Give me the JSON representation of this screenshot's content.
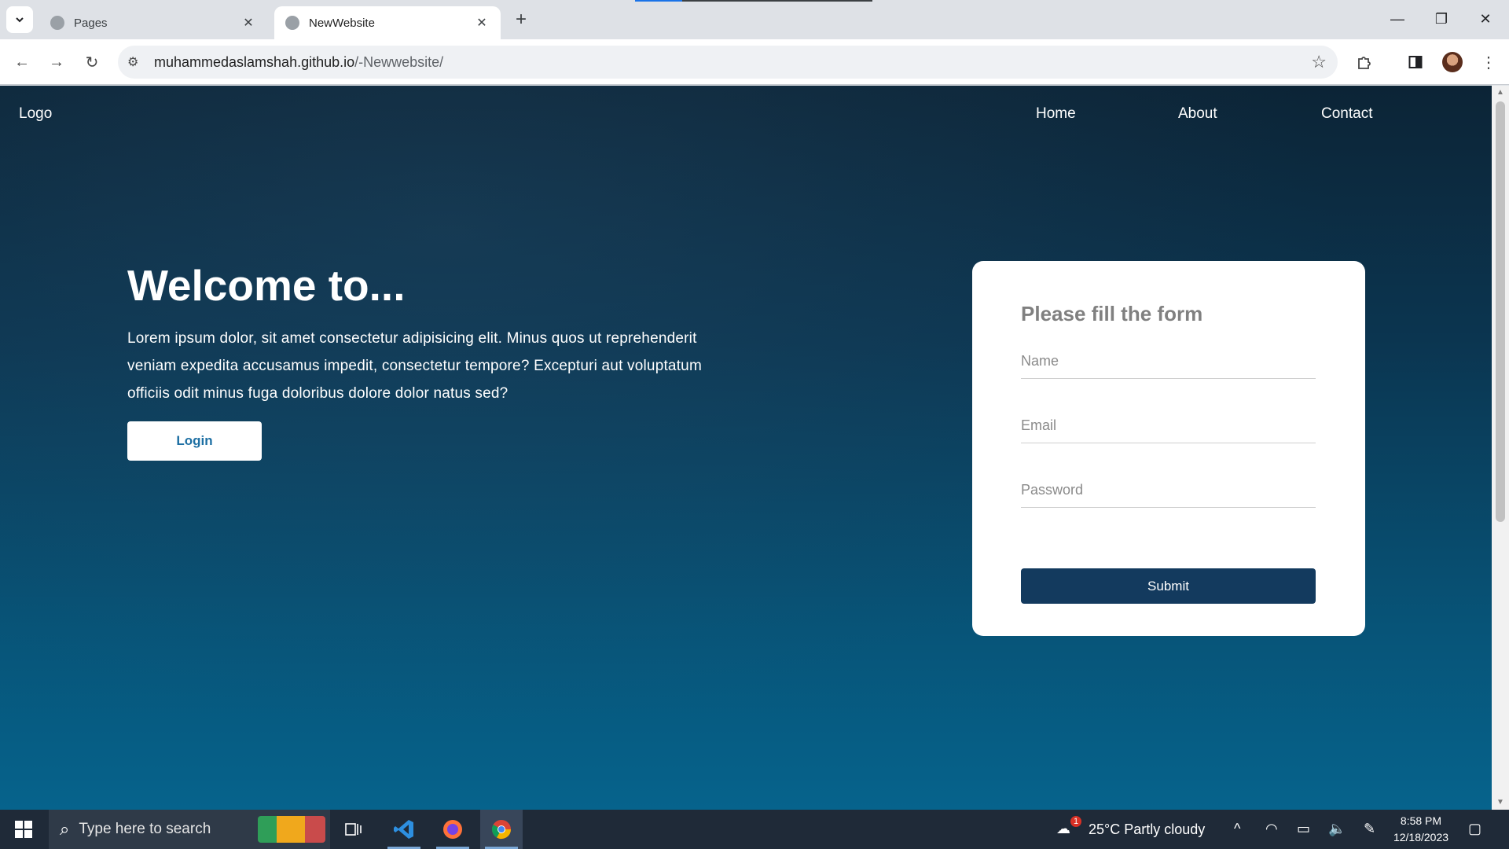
{
  "browser": {
    "tabs": [
      {
        "title": "Pages",
        "active": false
      },
      {
        "title": "NewWebsite",
        "active": true
      }
    ],
    "url_host": "muhammedaslamshah.github.io",
    "url_path": "/-Newwebsite/",
    "icons": {
      "tab_list": "chevron-down-icon",
      "close": "close-icon",
      "new_tab": "plus-icon",
      "back": "back-arrow-icon",
      "forward": "forward-arrow-icon",
      "reload": "reload-icon",
      "site_settings": "tune-icon",
      "bookmark": "star-icon",
      "extensions": "puzzle-icon",
      "side_panel": "side-panel-icon",
      "menu": "kebab-menu-icon"
    }
  },
  "page": {
    "nav": {
      "logo": "Logo",
      "links": [
        "Home",
        "About",
        "Contact"
      ]
    },
    "hero": {
      "title": "Welcome to...",
      "text": "Lorem ipsum dolor, sit amet consectetur adipisicing elit. Minus quos ut reprehenderit veniam expedita accusamus impedit, consectetur tempore? Excepturi aut voluptatum officiis odit minus fuga doloribus dolore dolor natus sed?",
      "login_label": "Login"
    },
    "form": {
      "title": "Please fill the form",
      "name_placeholder": "Name",
      "email_placeholder": "Email",
      "password_placeholder": "Password",
      "submit_label": "Submit"
    },
    "colors": {
      "submit_bg": "#133a5e",
      "login_text": "#1d6fa3"
    }
  },
  "taskbar": {
    "search_placeholder": "Type here to search",
    "weather": "25°C  Partly cloudy",
    "weather_badge": "1",
    "time": "8:58 PM",
    "date": "12/18/2023",
    "apps": [
      "task-view-icon",
      "vscode-icon",
      "firefox-icon",
      "chrome-icon"
    ]
  }
}
